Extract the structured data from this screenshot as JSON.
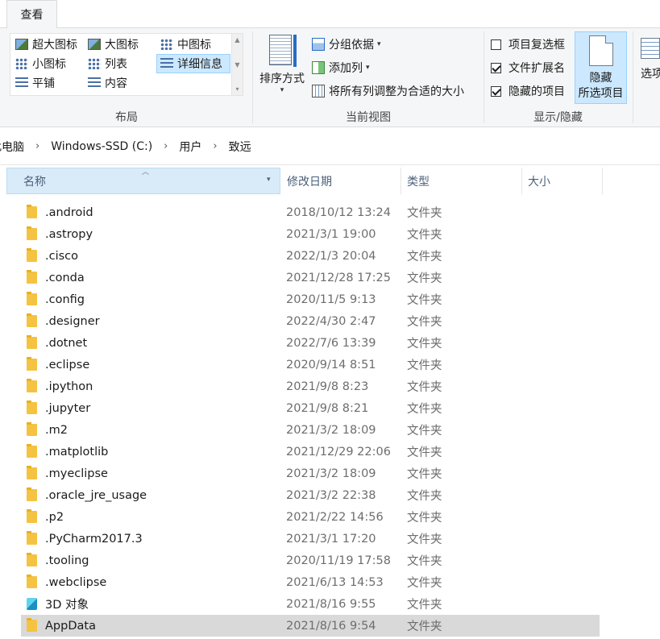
{
  "ribbon": {
    "active_tab": "查看",
    "layout_group": {
      "label": "布局",
      "items": [
        {
          "label": "超大图标",
          "icon": "extra-large-icons-icon"
        },
        {
          "label": "大图标",
          "icon": "large-icons-icon"
        },
        {
          "label": "中图标",
          "icon": "medium-icons-icon"
        },
        {
          "label": "小图标",
          "icon": "small-icons-icon"
        },
        {
          "label": "列表",
          "icon": "list-icon"
        },
        {
          "label": "详细信息",
          "icon": "details-icon",
          "selected": true
        },
        {
          "label": "平铺",
          "icon": "tiles-icon"
        },
        {
          "label": "内容",
          "icon": "content-icon"
        }
      ]
    },
    "current_view_group": {
      "label": "当前视图",
      "sort_by": "排序方式",
      "group_by": "分组依据",
      "add_column": "添加列",
      "fit_columns": "将所有列调整为合适的大小"
    },
    "show_hide_group": {
      "label": "显示/隐藏",
      "item_checkboxes": {
        "label": "项目复选框",
        "checked": false
      },
      "file_extensions": {
        "label": "文件扩展名",
        "checked": true
      },
      "hidden_items": {
        "label": "隐藏的项目",
        "checked": true
      },
      "hide_selected_line1": "隐藏",
      "hide_selected_line2": "所选项目"
    },
    "options_label": "选项"
  },
  "address": {
    "crumbs": [
      "此电脑",
      "Windows-SSD (C:)",
      "用户",
      "致远"
    ]
  },
  "columns": {
    "name": "名称",
    "date": "修改日期",
    "type": "类型",
    "size": "大小"
  },
  "files": [
    {
      "name": ".android",
      "date": "2018/10/12 13:24",
      "type": "文件夹",
      "icon": "folder-icon"
    },
    {
      "name": ".astropy",
      "date": "2021/3/1 19:00",
      "type": "文件夹",
      "icon": "folder-icon"
    },
    {
      "name": ".cisco",
      "date": "2022/1/3 20:04",
      "type": "文件夹",
      "icon": "folder-icon"
    },
    {
      "name": ".conda",
      "date": "2021/12/28 17:25",
      "type": "文件夹",
      "icon": "folder-icon"
    },
    {
      "name": ".config",
      "date": "2020/11/5 9:13",
      "type": "文件夹",
      "icon": "folder-icon"
    },
    {
      "name": ".designer",
      "date": "2022/4/30 2:47",
      "type": "文件夹",
      "icon": "folder-icon"
    },
    {
      "name": ".dotnet",
      "date": "2022/7/6 13:39",
      "type": "文件夹",
      "icon": "folder-icon"
    },
    {
      "name": ".eclipse",
      "date": "2020/9/14 8:51",
      "type": "文件夹",
      "icon": "folder-icon"
    },
    {
      "name": ".ipython",
      "date": "2021/9/8 8:23",
      "type": "文件夹",
      "icon": "folder-icon"
    },
    {
      "name": ".jupyter",
      "date": "2021/9/8 8:21",
      "type": "文件夹",
      "icon": "folder-icon"
    },
    {
      "name": ".m2",
      "date": "2021/3/2 18:09",
      "type": "文件夹",
      "icon": "folder-icon"
    },
    {
      "name": ".matplotlib",
      "date": "2021/12/29 22:06",
      "type": "文件夹",
      "icon": "folder-icon"
    },
    {
      "name": ".myeclipse",
      "date": "2021/3/2 18:09",
      "type": "文件夹",
      "icon": "folder-icon"
    },
    {
      "name": ".oracle_jre_usage",
      "date": "2021/3/2 22:38",
      "type": "文件夹",
      "icon": "folder-icon"
    },
    {
      "name": ".p2",
      "date": "2021/2/22 14:56",
      "type": "文件夹",
      "icon": "folder-icon"
    },
    {
      "name": ".PyCharm2017.3",
      "date": "2021/3/1 17:20",
      "type": "文件夹",
      "icon": "folder-icon"
    },
    {
      "name": ".tooling",
      "date": "2020/11/19 17:58",
      "type": "文件夹",
      "icon": "folder-icon"
    },
    {
      "name": ".webclipse",
      "date": "2021/6/13 14:53",
      "type": "文件夹",
      "icon": "folder-icon"
    },
    {
      "name": "3D 对象",
      "date": "2021/8/16 9:55",
      "type": "文件夹",
      "icon": "3d-objects-icon"
    },
    {
      "name": "AppData",
      "date": "2021/8/16 9:54",
      "type": "文件夹",
      "icon": "folder-icon",
      "selected": true
    }
  ]
}
